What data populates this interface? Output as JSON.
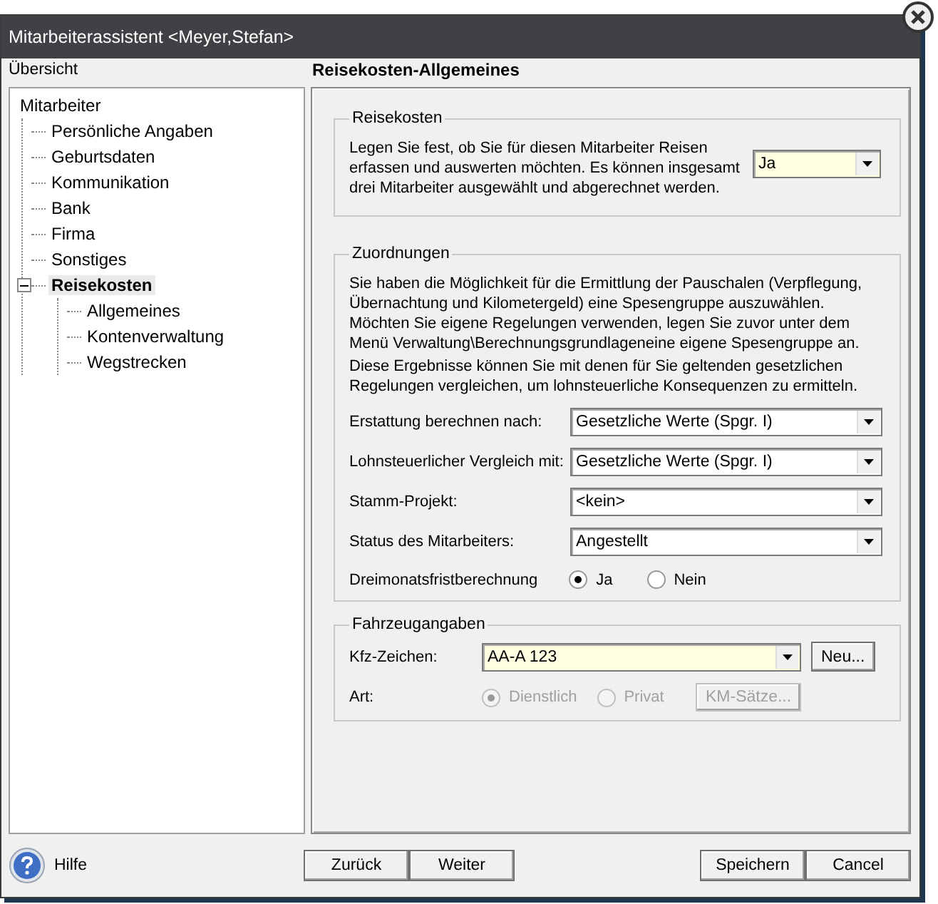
{
  "window": {
    "title": "Mitarbeiterassistent <Meyer,Stefan>"
  },
  "sidebar": {
    "title": "Übersicht",
    "tree": [
      {
        "label": "Mitarbeiter",
        "selected": false,
        "children": [
          {
            "label": "Persönliche Angaben",
            "selected": false
          },
          {
            "label": "Geburtsdaten",
            "selected": false
          },
          {
            "label": "Kommunikation",
            "selected": false
          },
          {
            "label": "Bank",
            "selected": false
          },
          {
            "label": "Firma",
            "selected": false
          },
          {
            "label": "Sonstiges",
            "selected": false
          },
          {
            "label": "Reisekosten",
            "selected": true,
            "expanded": true,
            "children": [
              {
                "label": "Allgemeines",
                "selected": false
              },
              {
                "label": "Kontenverwaltung",
                "selected": false
              },
              {
                "label": "Wegstrecken",
                "selected": false
              }
            ]
          }
        ]
      }
    ]
  },
  "page": {
    "title": "Reisekosten-Allgemeines",
    "reisekosten": {
      "title": "Reisekosten",
      "text": "Legen Sie fest, ob Sie für diesen Mitarbeiter Reisen erfassen und auswerten möchten. Es können insgesamt drei Mitarbeiter ausgewählt und abgerechnet werden.",
      "value": "Ja",
      "highlighted": true
    },
    "zuordnungen": {
      "title": "Zuordnungen",
      "text": "Sie haben die Möglichkeit für die Ermittlung der Pauschalen (Verpflegung, Übernachtung und Kilometergeld) eine Spesengruppe auszuwählen. Möchten Sie eigene Regelungen verwenden, legen Sie zuvor unter dem Menü Verwaltung\\Berechnungsgrundlageneine eigene Spesengruppe an.",
      "text2": "Diese Ergebnisse können Sie mit denen für Sie geltenden gesetzlichen Regelungen vergleichen, um lohnsteuerliche Konsequenzen zu ermitteln.",
      "fields": [
        {
          "kind": "dropdown",
          "label": "Erstattung berechnen nach:",
          "value": "Gesetzliche Werte (Spgr. I)",
          "highlighted": false
        },
        {
          "kind": "dropdown",
          "label": "Lohnsteuerlicher Vergleich mit:",
          "value": "Gesetzliche Werte (Spgr. I)",
          "highlighted": false
        },
        {
          "kind": "dropdown",
          "label": "Stamm-Projekt:",
          "value": "<kein>",
          "highlighted": false
        },
        {
          "kind": "dropdown",
          "label": "Status des Mitarbeiters:",
          "value": "Angestellt",
          "highlighted": false
        },
        {
          "kind": "radio",
          "label": "Dreimonatsfristberechnung",
          "disabled": false,
          "options": [
            {
              "label": "Ja",
              "selected": true
            },
            {
              "label": "Nein",
              "selected": false
            }
          ]
        }
      ]
    },
    "fahrzeug": {
      "title": "Fahrzeugangaben",
      "kfz": {
        "label": "Kfz-Zeichen:",
        "value": "AA-A 123",
        "highlighted": true,
        "button": "Neu..."
      },
      "art": {
        "label": "Art:",
        "disabled": true,
        "options": [
          {
            "label": "Dienstlich",
            "selected": true
          },
          {
            "label": "Privat",
            "selected": false
          }
        ],
        "button": "KM-Sätze..."
      }
    }
  },
  "footer": {
    "help": "Hilfe",
    "nav_buttons": [
      "Zurück",
      "Weiter"
    ],
    "action_buttons": [
      "Speichern",
      "Cancel"
    ]
  }
}
